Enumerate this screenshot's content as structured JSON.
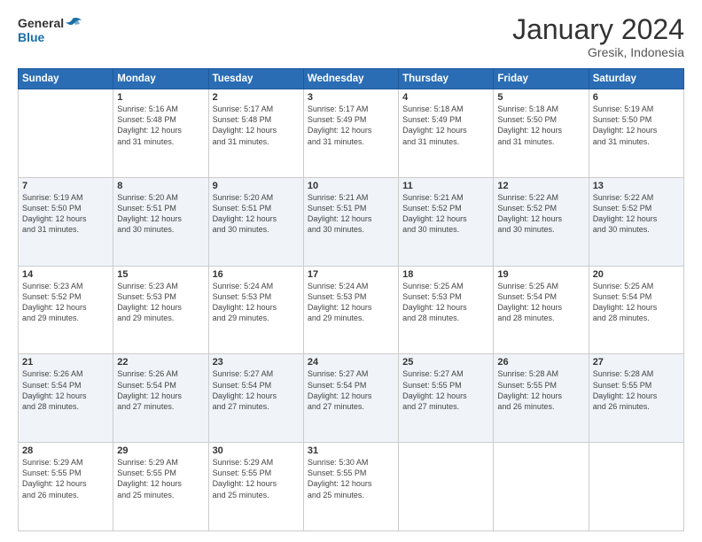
{
  "header": {
    "logo_general": "General",
    "logo_blue": "Blue",
    "month_year": "January 2024",
    "location": "Gresik, Indonesia"
  },
  "days_of_week": [
    "Sunday",
    "Monday",
    "Tuesday",
    "Wednesday",
    "Thursday",
    "Friday",
    "Saturday"
  ],
  "weeks": [
    [
      {
        "day": "",
        "info": ""
      },
      {
        "day": "1",
        "info": "Sunrise: 5:16 AM\nSunset: 5:48 PM\nDaylight: 12 hours\nand 31 minutes."
      },
      {
        "day": "2",
        "info": "Sunrise: 5:17 AM\nSunset: 5:48 PM\nDaylight: 12 hours\nand 31 minutes."
      },
      {
        "day": "3",
        "info": "Sunrise: 5:17 AM\nSunset: 5:49 PM\nDaylight: 12 hours\nand 31 minutes."
      },
      {
        "day": "4",
        "info": "Sunrise: 5:18 AM\nSunset: 5:49 PM\nDaylight: 12 hours\nand 31 minutes."
      },
      {
        "day": "5",
        "info": "Sunrise: 5:18 AM\nSunset: 5:50 PM\nDaylight: 12 hours\nand 31 minutes."
      },
      {
        "day": "6",
        "info": "Sunrise: 5:19 AM\nSunset: 5:50 PM\nDaylight: 12 hours\nand 31 minutes."
      }
    ],
    [
      {
        "day": "7",
        "info": "Sunrise: 5:19 AM\nSunset: 5:50 PM\nDaylight: 12 hours\nand 31 minutes."
      },
      {
        "day": "8",
        "info": "Sunrise: 5:20 AM\nSunset: 5:51 PM\nDaylight: 12 hours\nand 30 minutes."
      },
      {
        "day": "9",
        "info": "Sunrise: 5:20 AM\nSunset: 5:51 PM\nDaylight: 12 hours\nand 30 minutes."
      },
      {
        "day": "10",
        "info": "Sunrise: 5:21 AM\nSunset: 5:51 PM\nDaylight: 12 hours\nand 30 minutes."
      },
      {
        "day": "11",
        "info": "Sunrise: 5:21 AM\nSunset: 5:52 PM\nDaylight: 12 hours\nand 30 minutes."
      },
      {
        "day": "12",
        "info": "Sunrise: 5:22 AM\nSunset: 5:52 PM\nDaylight: 12 hours\nand 30 minutes."
      },
      {
        "day": "13",
        "info": "Sunrise: 5:22 AM\nSunset: 5:52 PM\nDaylight: 12 hours\nand 30 minutes."
      }
    ],
    [
      {
        "day": "14",
        "info": "Sunrise: 5:23 AM\nSunset: 5:52 PM\nDaylight: 12 hours\nand 29 minutes."
      },
      {
        "day": "15",
        "info": "Sunrise: 5:23 AM\nSunset: 5:53 PM\nDaylight: 12 hours\nand 29 minutes."
      },
      {
        "day": "16",
        "info": "Sunrise: 5:24 AM\nSunset: 5:53 PM\nDaylight: 12 hours\nand 29 minutes."
      },
      {
        "day": "17",
        "info": "Sunrise: 5:24 AM\nSunset: 5:53 PM\nDaylight: 12 hours\nand 29 minutes."
      },
      {
        "day": "18",
        "info": "Sunrise: 5:25 AM\nSunset: 5:53 PM\nDaylight: 12 hours\nand 28 minutes."
      },
      {
        "day": "19",
        "info": "Sunrise: 5:25 AM\nSunset: 5:54 PM\nDaylight: 12 hours\nand 28 minutes."
      },
      {
        "day": "20",
        "info": "Sunrise: 5:25 AM\nSunset: 5:54 PM\nDaylight: 12 hours\nand 28 minutes."
      }
    ],
    [
      {
        "day": "21",
        "info": "Sunrise: 5:26 AM\nSunset: 5:54 PM\nDaylight: 12 hours\nand 28 minutes."
      },
      {
        "day": "22",
        "info": "Sunrise: 5:26 AM\nSunset: 5:54 PM\nDaylight: 12 hours\nand 27 minutes."
      },
      {
        "day": "23",
        "info": "Sunrise: 5:27 AM\nSunset: 5:54 PM\nDaylight: 12 hours\nand 27 minutes."
      },
      {
        "day": "24",
        "info": "Sunrise: 5:27 AM\nSunset: 5:54 PM\nDaylight: 12 hours\nand 27 minutes."
      },
      {
        "day": "25",
        "info": "Sunrise: 5:27 AM\nSunset: 5:55 PM\nDaylight: 12 hours\nand 27 minutes."
      },
      {
        "day": "26",
        "info": "Sunrise: 5:28 AM\nSunset: 5:55 PM\nDaylight: 12 hours\nand 26 minutes."
      },
      {
        "day": "27",
        "info": "Sunrise: 5:28 AM\nSunset: 5:55 PM\nDaylight: 12 hours\nand 26 minutes."
      }
    ],
    [
      {
        "day": "28",
        "info": "Sunrise: 5:29 AM\nSunset: 5:55 PM\nDaylight: 12 hours\nand 26 minutes."
      },
      {
        "day": "29",
        "info": "Sunrise: 5:29 AM\nSunset: 5:55 PM\nDaylight: 12 hours\nand 25 minutes."
      },
      {
        "day": "30",
        "info": "Sunrise: 5:29 AM\nSunset: 5:55 PM\nDaylight: 12 hours\nand 25 minutes."
      },
      {
        "day": "31",
        "info": "Sunrise: 5:30 AM\nSunset: 5:55 PM\nDaylight: 12 hours\nand 25 minutes."
      },
      {
        "day": "",
        "info": ""
      },
      {
        "day": "",
        "info": ""
      },
      {
        "day": "",
        "info": ""
      }
    ]
  ]
}
